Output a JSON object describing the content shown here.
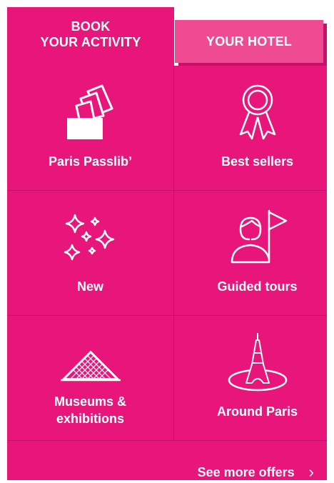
{
  "tabs": {
    "active": {
      "label": "BOOK\nYOUR ACTIVITY"
    },
    "inactive": {
      "label": "YOUR HOTEL"
    }
  },
  "grid": {
    "items": [
      {
        "label": "Paris Passlib’",
        "icon": "tickets-icon"
      },
      {
        "label": "Best sellers",
        "icon": "award-ribbon-icon"
      },
      {
        "label": "New",
        "icon": "sparkles-icon"
      },
      {
        "label": "Guided tours",
        "icon": "guide-flag-icon"
      },
      {
        "label": "Museums &\nexhibitions",
        "icon": "louvre-pyramid-icon"
      },
      {
        "label": "Around Paris",
        "icon": "eiffel-tower-icon"
      }
    ]
  },
  "footer": {
    "see_more_label": "See more offers",
    "chevron": "›"
  },
  "colors": {
    "primary": "#e8157a",
    "inactive_tab": "#ef4b93",
    "inactive_tab_shadow": "#c7106a",
    "text": "#ffffff"
  }
}
